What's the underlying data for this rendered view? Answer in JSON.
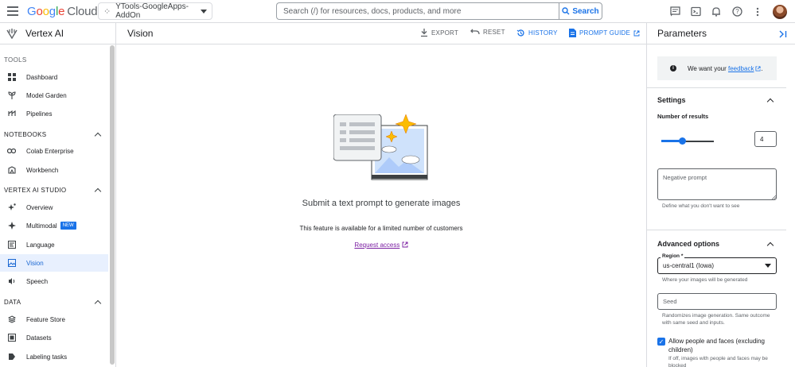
{
  "topbar": {
    "logo": {
      "g": "G",
      "o1": "o",
      "o2": "o",
      "g2": "g",
      "l": "l",
      "e": "e",
      "cloud": "Cloud"
    },
    "project": "YTools-GoogleApps-AddOn",
    "search_placeholder": "Search (/) for resources, docs, products, and more",
    "search_button": "Search"
  },
  "sidebar": {
    "title": "Vertex AI",
    "tools_label": "TOOLS",
    "tools": [
      {
        "label": "Dashboard",
        "icon": "dashboard-icon"
      },
      {
        "label": "Model Garden",
        "icon": "model-garden-icon"
      },
      {
        "label": "Pipelines",
        "icon": "pipelines-icon"
      }
    ],
    "notebooks_label": "NOTEBOOKS",
    "notebooks": [
      {
        "label": "Colab Enterprise",
        "icon": "colab-icon"
      },
      {
        "label": "Workbench",
        "icon": "workbench-icon"
      }
    ],
    "studio_label": "VERTEX AI STUDIO",
    "studio": [
      {
        "label": "Overview",
        "icon": "overview-icon"
      },
      {
        "label": "Multimodal",
        "icon": "multimodal-icon",
        "badge": "NEW"
      },
      {
        "label": "Language",
        "icon": "language-icon"
      },
      {
        "label": "Vision",
        "icon": "vision-icon",
        "active": true
      },
      {
        "label": "Speech",
        "icon": "speech-icon"
      }
    ],
    "data_label": "DATA",
    "data": [
      {
        "label": "Feature Store",
        "icon": "feature-store-icon"
      },
      {
        "label": "Datasets",
        "icon": "datasets-icon"
      },
      {
        "label": "Labeling tasks",
        "icon": "labeling-icon"
      }
    ]
  },
  "main": {
    "title": "Vision",
    "export": "EXPORT",
    "reset": "RESET",
    "history": "HISTORY",
    "prompt_guide": "PROMPT GUIDE",
    "empty_title": "Submit a text prompt to generate images",
    "empty_sub": "This feature is available for a limited number of customers",
    "request_access": "Request access"
  },
  "panel": {
    "title": "Parameters",
    "feedback_prefix": "We want your ",
    "feedback_link": "feedback",
    "feedback_suffix": ".",
    "settings": "Settings",
    "num_results_label": "Number of results",
    "num_results": "4",
    "num_results_fraction": 0.4,
    "negative_prompt": "Negative prompt",
    "negative_hint": "Define what you don't want to see",
    "advanced": "Advanced options",
    "region_label": "Region *",
    "region_value": "us-central1 (Iowa)",
    "region_hint": "Where your images will be generated",
    "seed_placeholder": "Seed",
    "seed_hint": "Randomizes image generation. Same outcome with same seed and inputs.",
    "allow_label": "Allow people and faces (excluding children)",
    "allow_hint": "If off, images with people and faces may be blocked"
  },
  "colors": {
    "accent": "#1a73e8",
    "active_bg": "#e8f0fe",
    "request": "#7b1fa2",
    "star": "#fbbc04"
  }
}
